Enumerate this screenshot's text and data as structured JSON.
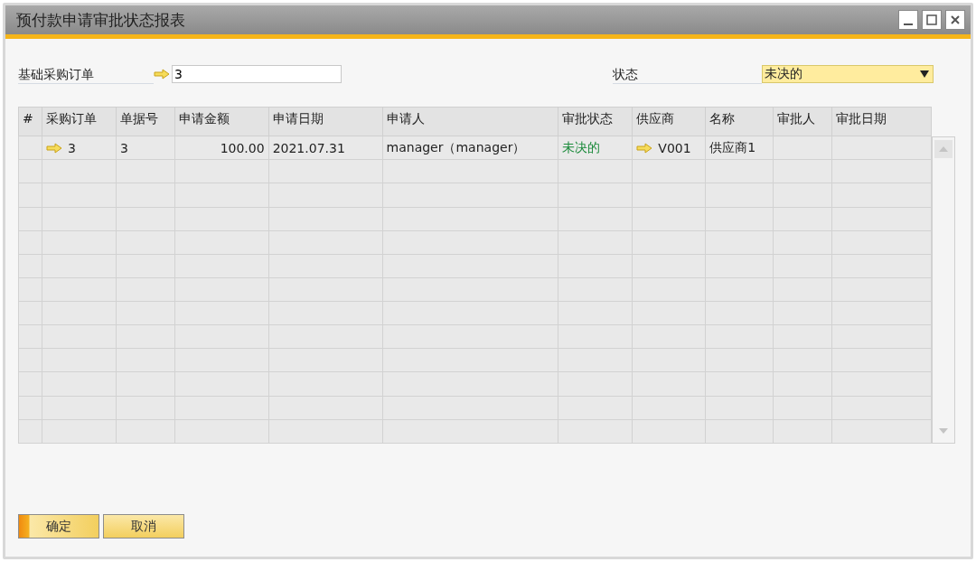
{
  "window": {
    "title": "预付款申请审批状态报表"
  },
  "filters": {
    "base_po": {
      "label": "基础采购订单",
      "value": "3"
    },
    "status": {
      "label": "状态",
      "value": "未决的"
    }
  },
  "table": {
    "columns": [
      "#",
      "采购订单",
      "单据号",
      "申请金额",
      "申请日期",
      "申请人",
      "审批状态",
      "供应商",
      "名称",
      "审批人",
      "审批日期"
    ],
    "rows": [
      {
        "cells": [
          {},
          {
            "text": "3",
            "link": true
          },
          {
            "text": "3"
          },
          {
            "text": "100.00"
          },
          {
            "text": "2021.07.31"
          },
          {
            "text": "manager（manager）"
          },
          {
            "text": "未决的",
            "color": "#1a8a3a"
          },
          {
            "text": "V001",
            "link": true
          },
          {
            "text": "供应商1"
          },
          {},
          {}
        ]
      }
    ]
  },
  "buttons": [
    {
      "label": "确定",
      "default": true
    },
    {
      "label": "取消",
      "default": false
    }
  ]
}
